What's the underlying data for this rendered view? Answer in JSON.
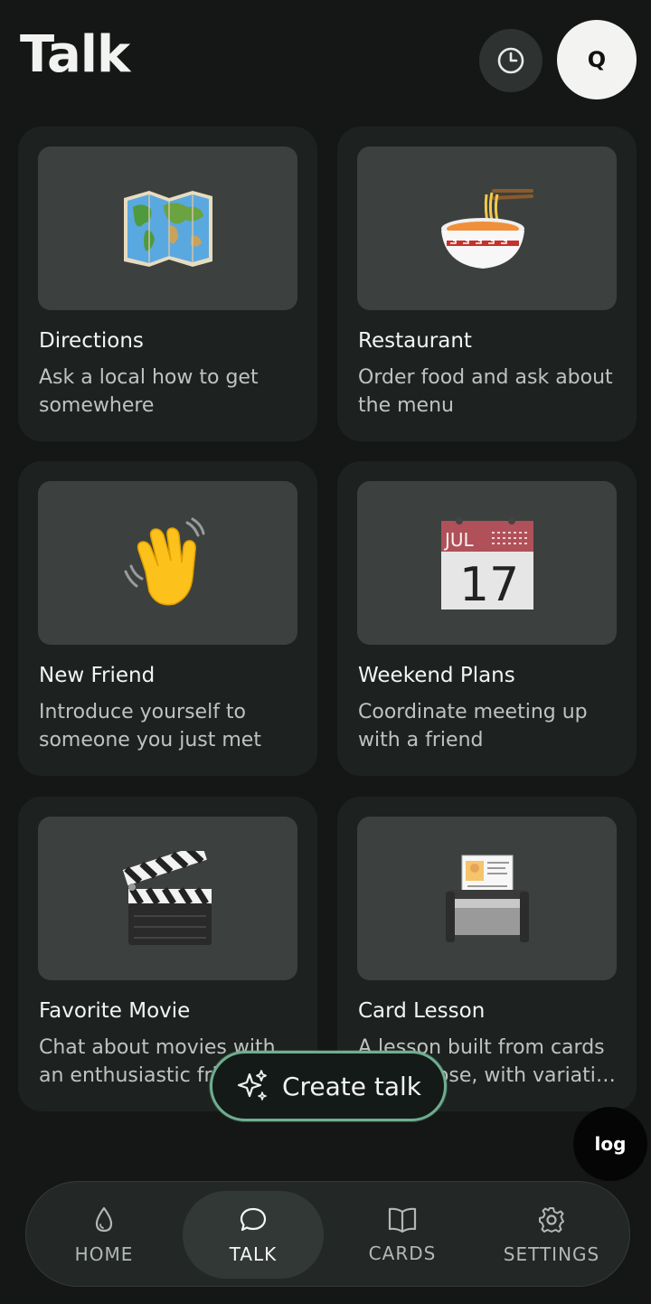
{
  "header": {
    "title": "Talk",
    "avatar_initial": "Q"
  },
  "cards": [
    {
      "title": "Directions",
      "desc": [
        "Ask a local how to get",
        "somewhere"
      ],
      "emoji": "🗺️"
    },
    {
      "title": "Restaurant",
      "desc": [
        "Order food and ask about",
        "the menu"
      ],
      "emoji": "🍜"
    },
    {
      "title": "New Friend",
      "desc": [
        "Introduce yourself to",
        "someone you just met"
      ],
      "emoji": "👋"
    },
    {
      "title": "Weekend Plans",
      "desc": [
        "Coordinate meeting up",
        "with a friend"
      ],
      "emoji": "📅"
    },
    {
      "title": "Favorite Movie",
      "desc": [
        "Chat about movies with",
        "an enthusiastic friend"
      ],
      "emoji": "🎬"
    },
    {
      "title": "Card Lesson",
      "desc": [
        "A lesson built from cards",
        "you choose, with variati…"
      ],
      "emoji": "📇"
    }
  ],
  "create_button": {
    "label": "Create talk"
  },
  "log_button": {
    "label": "log"
  },
  "nav": [
    {
      "label": "HOME",
      "icon": "drop-icon"
    },
    {
      "label": "TALK",
      "icon": "chat-bubble-icon"
    },
    {
      "label": "CARDS",
      "icon": "open-book-icon"
    },
    {
      "label": "SETTINGS",
      "icon": "gear-icon"
    }
  ],
  "colors": {
    "background": "#141716",
    "card": "#1d2220",
    "thumb": "#3c403e",
    "accent_outline": "#6fae8f"
  }
}
